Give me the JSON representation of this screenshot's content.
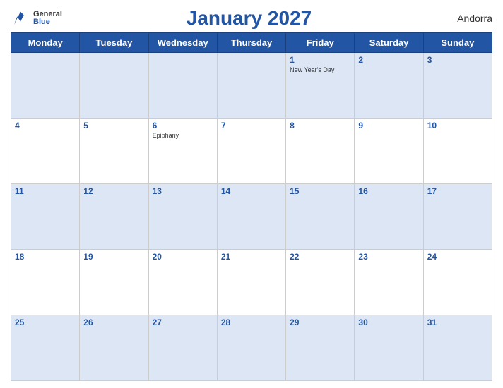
{
  "logo": {
    "general": "General",
    "blue": "Blue"
  },
  "header": {
    "title": "January 2027",
    "country": "Andorra"
  },
  "weekdays": [
    "Monday",
    "Tuesday",
    "Wednesday",
    "Thursday",
    "Friday",
    "Saturday",
    "Sunday"
  ],
  "weeks": [
    [
      {
        "day": "",
        "holiday": ""
      },
      {
        "day": "",
        "holiday": ""
      },
      {
        "day": "",
        "holiday": ""
      },
      {
        "day": "",
        "holiday": ""
      },
      {
        "day": "1",
        "holiday": "New Year's Day"
      },
      {
        "day": "2",
        "holiday": ""
      },
      {
        "day": "3",
        "holiday": ""
      }
    ],
    [
      {
        "day": "4",
        "holiday": ""
      },
      {
        "day": "5",
        "holiday": ""
      },
      {
        "day": "6",
        "holiday": "Epiphany"
      },
      {
        "day": "7",
        "holiday": ""
      },
      {
        "day": "8",
        "holiday": ""
      },
      {
        "day": "9",
        "holiday": ""
      },
      {
        "day": "10",
        "holiday": ""
      }
    ],
    [
      {
        "day": "11",
        "holiday": ""
      },
      {
        "day": "12",
        "holiday": ""
      },
      {
        "day": "13",
        "holiday": ""
      },
      {
        "day": "14",
        "holiday": ""
      },
      {
        "day": "15",
        "holiday": ""
      },
      {
        "day": "16",
        "holiday": ""
      },
      {
        "day": "17",
        "holiday": ""
      }
    ],
    [
      {
        "day": "18",
        "holiday": ""
      },
      {
        "day": "19",
        "holiday": ""
      },
      {
        "day": "20",
        "holiday": ""
      },
      {
        "day": "21",
        "holiday": ""
      },
      {
        "day": "22",
        "holiday": ""
      },
      {
        "day": "23",
        "holiday": ""
      },
      {
        "day": "24",
        "holiday": ""
      }
    ],
    [
      {
        "day": "25",
        "holiday": ""
      },
      {
        "day": "26",
        "holiday": ""
      },
      {
        "day": "27",
        "holiday": ""
      },
      {
        "day": "28",
        "holiday": ""
      },
      {
        "day": "29",
        "holiday": ""
      },
      {
        "day": "30",
        "holiday": ""
      },
      {
        "day": "31",
        "holiday": ""
      }
    ]
  ]
}
